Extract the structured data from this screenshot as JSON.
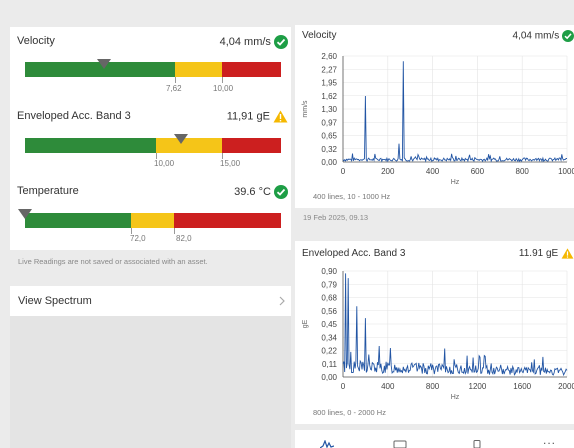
{
  "left": {
    "readings": [
      {
        "label": "Velocity",
        "value": "4,04 mm/s",
        "status": "ok",
        "thresholds": [
          "7,62",
          "10,00"
        ],
        "marker_fraction": 0.31
      },
      {
        "label": "Enveloped Acc. Band 3",
        "value": "11,91 gE",
        "status": "warning",
        "thresholds": [
          "10,00",
          "15,00"
        ],
        "marker_fraction": 0.61
      },
      {
        "label": "Temperature",
        "value": "39.6 °C",
        "status": "ok",
        "thresholds": [
          "72,0",
          "82,0"
        ],
        "marker_fraction": 0.0
      }
    ],
    "note": "Live Readings are not saved or associated with an asset.",
    "view_spectrum": "View Spectrum"
  },
  "colors": {
    "green": "#2e8b3a",
    "yellow": "#f5c518",
    "red": "#cc1f1f",
    "ok": "#1e9e46",
    "warn": "#f5b800",
    "line": "#2255a4"
  },
  "icons": {
    "ok": "check-circle-icon",
    "warning": "warning-triangle-icon",
    "chevron": "chevron-right-icon"
  },
  "velocity_spectrum": {
    "title": "Velocity",
    "value": "4,04 mm/s",
    "footer": "400 lines, 10 - 1000 Hz",
    "timestamp": "19 Feb 2025, 09.13"
  },
  "envelope_spectrum": {
    "title": "Enveloped Acc. Band 3",
    "value": "11.91 gE",
    "footer": "800 lines, 0 - 2000 Hz"
  },
  "chart_data": [
    {
      "type": "line",
      "title": "",
      "xlabel": "Hz",
      "ylabel": "mm/s",
      "xlim": [
        0,
        1000
      ],
      "ylim": [
        0,
        2.6
      ],
      "x_ticks": [
        "0",
        "200",
        "400",
        "600",
        "800",
        "1000"
      ],
      "y_ticks": [
        "0,00",
        "0,32",
        "0,65",
        "0,97",
        "1,30",
        "1,62",
        "1,95",
        "2,27",
        "2,60"
      ],
      "peaks": [
        {
          "x": 100,
          "y": 1.62
        },
        {
          "x": 250,
          "y": 0.45
        },
        {
          "x": 270,
          "y": 2.47
        }
      ],
      "noise_level": 0.1
    },
    {
      "type": "line",
      "title": "",
      "xlabel": "Hz",
      "ylabel": "gE",
      "xlim": [
        0,
        2000
      ],
      "ylim": [
        0,
        0.9
      ],
      "x_ticks": [
        "0",
        "400",
        "800",
        "1200",
        "1600",
        "2000"
      ],
      "y_ticks": [
        "0,00",
        "0,11",
        "0,22",
        "0,34",
        "0,45",
        "0,56",
        "0,68",
        "0,79",
        "0,90"
      ],
      "peaks": [
        {
          "x": 20,
          "y": 0.88
        },
        {
          "x": 45,
          "y": 0.84
        },
        {
          "x": 120,
          "y": 0.6
        },
        {
          "x": 200,
          "y": 0.5
        }
      ],
      "noise_level": 0.12
    }
  ],
  "bottom_nav": {
    "icons": [
      "spectrum-icon",
      "report-icon",
      "phone-icon",
      "more-icon"
    ],
    "more": "..."
  }
}
